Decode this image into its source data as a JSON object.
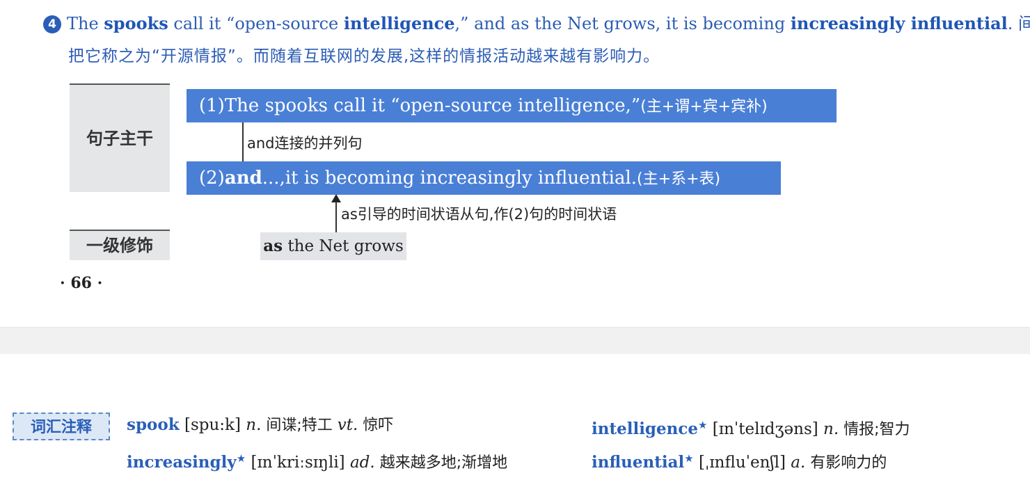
{
  "sentence": {
    "number": "4",
    "s1": "The ",
    "b1": "spooks",
    "s2": " call it “open-source ",
    "b2": "intelligence",
    "s3": ",” and as the Net grows, it is becoming ",
    "b3": "increasingly influential",
    "s4": ". 间谍们",
    "translation": "把它称之为“开源情报”。而随着互联网的发展,这样的情报活动越来越有影响力。"
  },
  "analysis": {
    "label_main": "句子主干",
    "label_mod": "一级修饰",
    "bar1_en": "(1)The spooks call it “open-source intelligence,”",
    "bar1_cn": "(主+谓+宾+宾补)",
    "connector_note": "and连接的并列句",
    "bar2_prefix": "(2)",
    "bar2_bold": "and",
    "bar2_en": "...,it is becoming increasingly influential.",
    "bar2_cn": "(主+系+表)",
    "clause_note": "as引导的时间状语从句,作(2)句的时间状语",
    "clause_bold": "as",
    "clause_text": " the Net grows"
  },
  "page_number": "· 66 ·",
  "vocab": {
    "tag": "词汇注释",
    "items": [
      {
        "word": "spook",
        "star": "",
        "phon": " [spu:k] ",
        "pos": "n.",
        "cn": " 间谍;特工 ",
        "pos2": "vt.",
        "cn2": " 惊吓"
      },
      {
        "word": "increasingly",
        "star": "★",
        "phon": " [ɪnˈkriːsɪŋli] ",
        "pos": "ad.",
        "cn": " 越来越多地;渐增地",
        "pos2": "",
        "cn2": ""
      },
      {
        "word": "intelligence",
        "star": "★",
        "phon": " [ɪnˈtelɪdʒəns] ",
        "pos": "n.",
        "cn": " 情报;智力",
        "pos2": "",
        "cn2": ""
      },
      {
        "word": "influential",
        "star": "★",
        "phon": " [ˌɪnfluˈenʃl] ",
        "pos": "a.",
        "cn": " 有影响力的",
        "pos2": "",
        "cn2": ""
      }
    ]
  }
}
